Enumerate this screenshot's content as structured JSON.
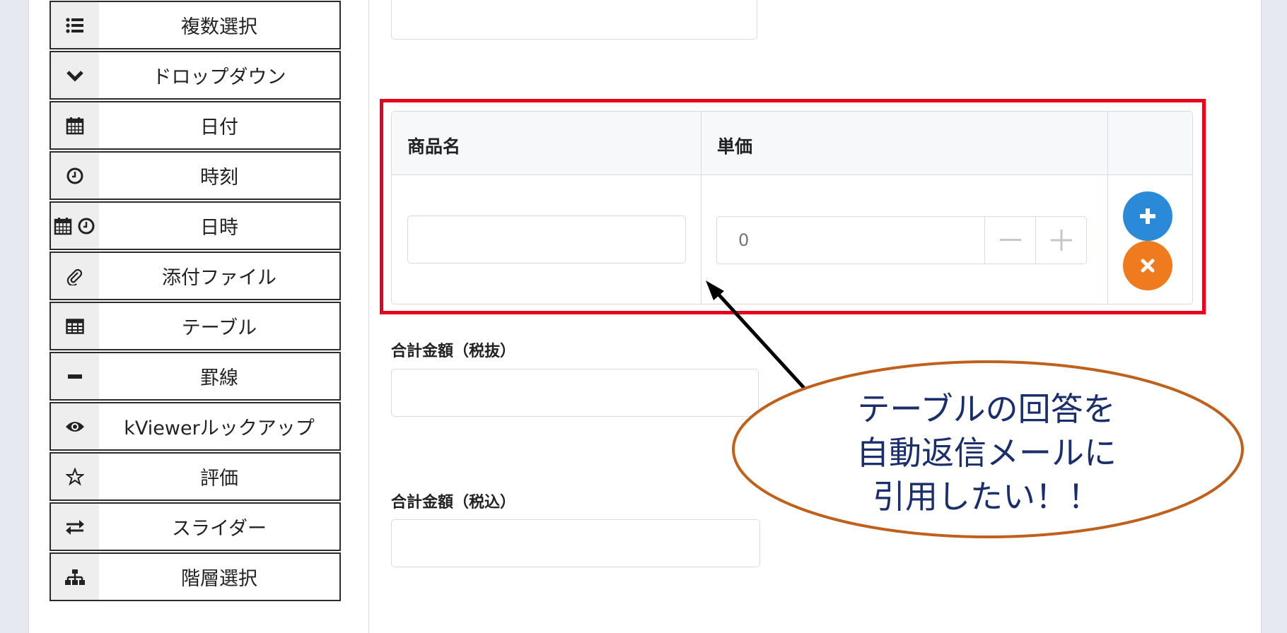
{
  "palette": {
    "items": [
      {
        "label": "複数選択",
        "icon": "list-icon"
      },
      {
        "label": "ドロップダウン",
        "icon": "chevron-down-icon"
      },
      {
        "label": "日付",
        "icon": "calendar-icon"
      },
      {
        "label": "時刻",
        "icon": "clock-icon"
      },
      {
        "label": "日時",
        "icon": "calendar-clock-icon"
      },
      {
        "label": "添付ファイル",
        "icon": "paperclip-icon"
      },
      {
        "label": "テーブル",
        "icon": "table-icon"
      },
      {
        "label": "罫線",
        "icon": "minus-icon"
      },
      {
        "label": "kViewerルックアップ",
        "icon": "eye-icon"
      },
      {
        "label": "評価",
        "icon": "star-icon"
      },
      {
        "label": "スライダー",
        "icon": "exchange-icon"
      },
      {
        "label": "階層選択",
        "icon": "sitemap-icon"
      }
    ]
  },
  "form": {
    "table": {
      "columns": [
        "商品名",
        "単価"
      ],
      "row": {
        "product_name": "",
        "unit_price_placeholder": "0"
      },
      "add_icon": "plus-icon",
      "remove_icon": "times-icon",
      "colors": {
        "add": "#2b8ad8",
        "remove": "#f07a1e"
      }
    },
    "fields": [
      {
        "label": "合計金額（税抜）",
        "value": ""
      },
      {
        "label": "合計金額（税込）",
        "value": ""
      }
    ]
  },
  "annotation": {
    "lines": [
      "テーブルの回答を",
      "自動返信メールに",
      "引用したい！！"
    ],
    "highlight_color": "#e8001c",
    "ellipse_color": "#c0601a",
    "text_color": "#1a2e6e"
  }
}
